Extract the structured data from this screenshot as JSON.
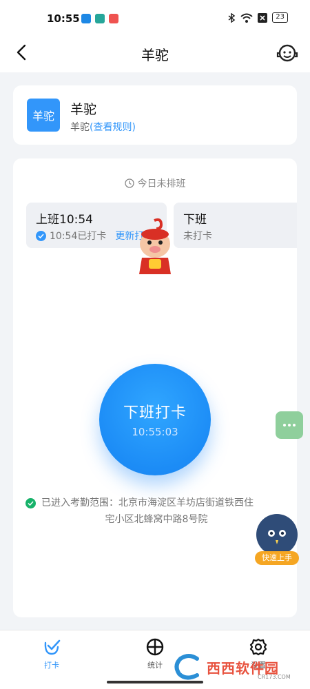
{
  "status_bar": {
    "time": "10:55",
    "battery": "23"
  },
  "header": {
    "title": "羊驼"
  },
  "group": {
    "logo_text": "羊驼",
    "name": "羊驼",
    "sub_prefix": "羊驼",
    "rule_link": "(查看规则)"
  },
  "schedule": {
    "text": "今日未排班"
  },
  "shifts": {
    "on": {
      "label": "上班10:54",
      "status": "10:54已打卡",
      "update": "更新打卡"
    },
    "off": {
      "label": "下班",
      "status": "未打卡"
    }
  },
  "punch": {
    "label": "下班打卡",
    "clock": "10:55:03"
  },
  "range": {
    "line1": "已进入考勤范围：北京市海淀区羊坊店街道铁西住",
    "line2": "宅小区北蜂窝中路8号院"
  },
  "helper": {
    "label": "快速上手"
  },
  "tabs": [
    {
      "label": "打卡",
      "icon": "check-icon",
      "active": true
    },
    {
      "label": "统计",
      "icon": "pie-chart-icon",
      "active": false
    },
    {
      "label": "设置",
      "icon": "gear-icon",
      "active": false
    }
  ],
  "watermark": {
    "text": "西西软件园",
    "url": "CR173.COM"
  },
  "colors": {
    "accent": "#3296fa",
    "success": "#17b26a",
    "punch": "#1c8cf6"
  }
}
